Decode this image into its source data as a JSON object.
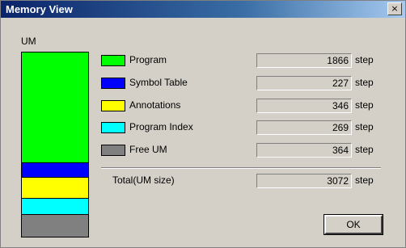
{
  "window": {
    "title": "Memory View",
    "close_label": "×"
  },
  "um_label": "UM",
  "legend": [
    {
      "label": "Program",
      "value": "1866",
      "unit": "step",
      "color": "#00ff00",
      "steps": 1866
    },
    {
      "label": "Symbol Table",
      "value": "227",
      "unit": "step",
      "color": "#0000ff",
      "steps": 227
    },
    {
      "label": "Annotations",
      "value": "346",
      "unit": "step",
      "color": "#ffff00",
      "steps": 346
    },
    {
      "label": "Program Index",
      "value": "269",
      "unit": "step",
      "color": "#00ffff",
      "steps": 269
    },
    {
      "label": "Free UM",
      "value": "364",
      "unit": "step",
      "color": "#808080",
      "steps": 364
    }
  ],
  "total": {
    "label": "Total(UM size)",
    "value": "3072",
    "unit": "step"
  },
  "ok_label": "OK"
}
